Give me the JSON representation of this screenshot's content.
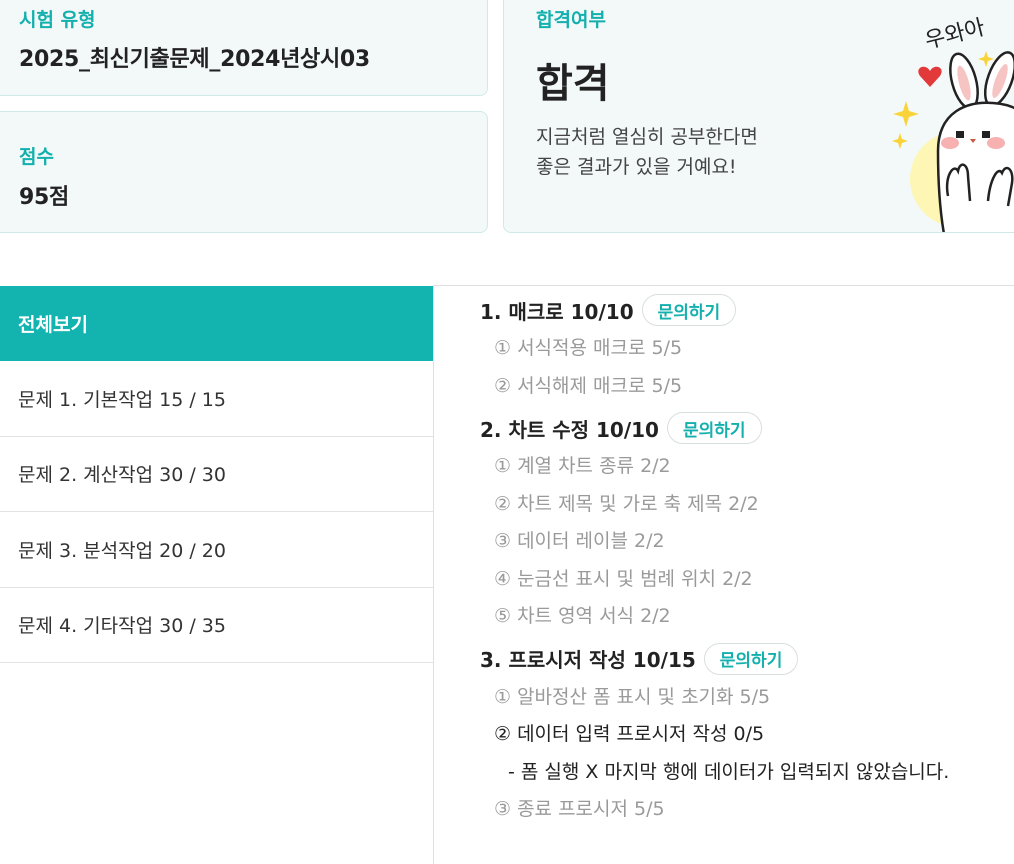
{
  "exam_type": {
    "label": "시험 유형",
    "value": "2025_최신기출문제_2024년상시03"
  },
  "score": {
    "label": "점수",
    "value": "95점"
  },
  "result": {
    "label": "합격여부",
    "value": "합격",
    "message_line1": "지금처럼 열심히 공부한다면",
    "message_line2": "좋은 결과가 있을 거예요!",
    "mascot_text": "우와아"
  },
  "nav": {
    "items": [
      {
        "label": "전체보기"
      },
      {
        "label": "문제 1. 기본작업 15 / 15"
      },
      {
        "label": "문제 2. 계산작업 30 / 30"
      },
      {
        "label": "문제 3. 분석작업 20 / 20"
      },
      {
        "label": "문제 4. 기타작업 30 / 35"
      }
    ]
  },
  "sections": [
    {
      "title": "1. 매크로 10/10",
      "inquiry": "문의하기",
      "items": [
        {
          "text": "① 서식적용 매크로 5/5"
        },
        {
          "text": "② 서식해제 매크로 5/5"
        }
      ]
    },
    {
      "title": "2. 차트 수정 10/10",
      "inquiry": "문의하기",
      "items": [
        {
          "text": "① 계열 차트 종류 2/2"
        },
        {
          "text": "② 차트 제목 및 가로 축 제목 2/2"
        },
        {
          "text": "③ 데이터 레이블 2/2"
        },
        {
          "text": "④ 눈금선 표시 및 범례 위치 2/2"
        },
        {
          "text": "⑤ 차트 영역 서식 2/2"
        }
      ]
    },
    {
      "title": "3. 프로시저 작성 10/15",
      "inquiry": "문의하기",
      "items": [
        {
          "text": "① 알바정산 폼 표시 및 초기화 5/5"
        },
        {
          "text": "② 데이터 입력 프로시저 작성 0/5",
          "note": "- 폼 실행 X 마지막 행에 데이터가 입력되지 않았습니다."
        },
        {
          "text": "③ 종료 프로시저 5/5"
        }
      ]
    }
  ],
  "colors": {
    "accent": "#13b3b0",
    "card_bg": "#f3f9f9",
    "muted_text": "#9a9a9a"
  }
}
